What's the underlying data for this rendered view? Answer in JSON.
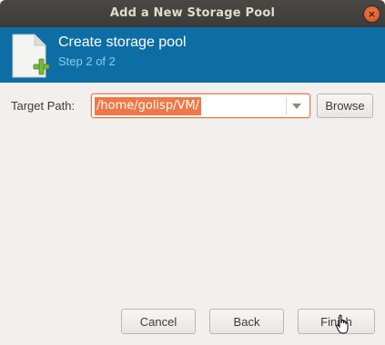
{
  "window": {
    "title": "Add a New Storage Pool",
    "close_symbol": "×"
  },
  "header": {
    "title": "Create storage pool",
    "subtitle": "Step 2 of 2",
    "icon": "new-document-icon",
    "background_color": "#0d6ea6"
  },
  "form": {
    "target_path_label": "Target Path:",
    "target_path_value": "/home/golisp/VM/",
    "browse_label": "Browse"
  },
  "footer": {
    "cancel_label": "Cancel",
    "back_label": "Back",
    "finish_label": "Finish"
  },
  "colors": {
    "accent": "#f07746",
    "titlebar": "#3c3b37",
    "window_bg": "#f1f0ee"
  }
}
